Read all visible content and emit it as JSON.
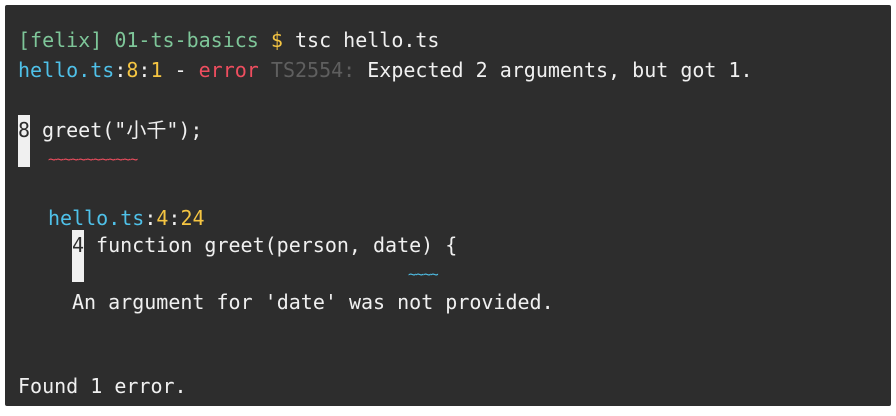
{
  "command_line": {
    "user": "[felix]",
    "directory": "01-ts-basics",
    "prompt": "$",
    "command": "tsc hello.ts"
  },
  "error": {
    "file": "hello.ts",
    "sep1": ":",
    "line": "8",
    "sep2": ":",
    "col": "1",
    "dash": " - ",
    "severity": "error",
    "code": "TS2554:",
    "message": "Expected 2 arguments, but got 1."
  },
  "snippet": {
    "line_number": "8",
    "code": "greet(\"小千\");",
    "squiggle": "~~~~~~~~~~~~"
  },
  "related": {
    "file": "hello.ts",
    "sep1": ":",
    "line": "4",
    "sep2": ":",
    "col": "24",
    "line_number": "4",
    "code": "function greet(person, date) {",
    "squiggle": "~~~~",
    "message": "An argument for 'date' was not provided."
  },
  "summary": "Found 1 error."
}
